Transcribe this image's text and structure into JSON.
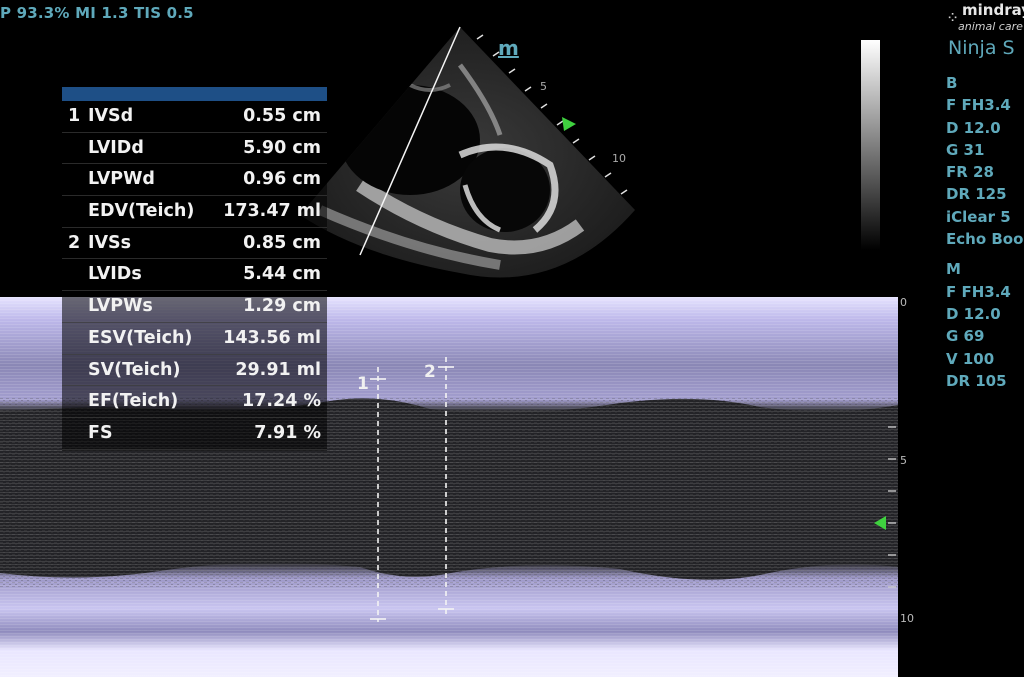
{
  "status_bar": {
    "text": "P 93.3%  MI 1.3 TIS 0.5"
  },
  "logo": {
    "brand": "mindray",
    "sub": "animal care"
  },
  "app_title": "Ninja S",
  "b_params": {
    "header": "B",
    "items": [
      "F FH3.4",
      "D 12.0",
      "G 31",
      "FR 28",
      "DR 125",
      "iClear 5",
      "Echo Boost"
    ]
  },
  "m_params": {
    "header": "M",
    "items": [
      "F FH3.4",
      "D 12.0",
      "G 69",
      "V 100",
      "DR 105"
    ]
  },
  "sector": {
    "mode_label": "m",
    "depth_labels": [
      "5",
      "10"
    ]
  },
  "depth_axis": {
    "labels": [
      "0",
      "5",
      "10"
    ]
  },
  "calipers": [
    "1",
    "2"
  ],
  "measurements": [
    {
      "index": "1",
      "name": "IVSd",
      "value": "0.55 cm"
    },
    {
      "index": "",
      "name": "LVIDd",
      "value": "5.90 cm"
    },
    {
      "index": "",
      "name": "LVPWd",
      "value": "0.96 cm"
    },
    {
      "index": "",
      "name": "EDV(Teich)",
      "value": "173.47 ml"
    },
    {
      "index": "2",
      "name": "IVSs",
      "value": "0.85 cm"
    },
    {
      "index": "",
      "name": "LVIDs",
      "value": "5.44 cm"
    },
    {
      "index": "",
      "name": "LVPWs",
      "value": "1.29 cm"
    },
    {
      "index": "",
      "name": "ESV(Teich)",
      "value": "143.56 ml"
    },
    {
      "index": "",
      "name": "SV(Teich)",
      "value": "29.91 ml"
    },
    {
      "index": "",
      "name": "EF(Teich)",
      "value": "17.24 %"
    },
    {
      "index": "",
      "name": "FS",
      "value": "7.91 %"
    }
  ],
  "colors": {
    "text_accent": "#5fa9bb",
    "panel_header": "#1e4f86",
    "mmode_tint": "#bcb8ec",
    "marker_green": "#3fd13f"
  }
}
